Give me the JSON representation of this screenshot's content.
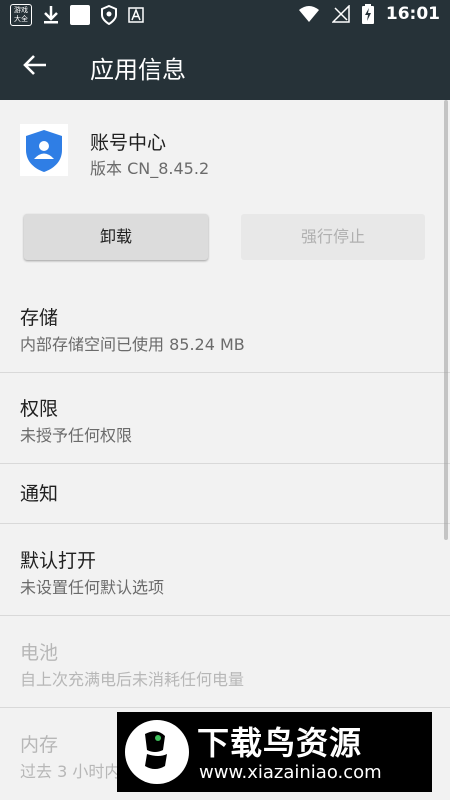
{
  "status_bar": {
    "game_icon_text": "游戏大全",
    "time": "16:01"
  },
  "app_bar": {
    "title": "应用信息"
  },
  "app": {
    "name": "账号中心",
    "version": "版本 CN_8.45.2"
  },
  "buttons": {
    "uninstall": "卸载",
    "force_stop": "强行停止"
  },
  "settings": [
    {
      "title": "存储",
      "subtitle": "内部存储空间已使用 85.24 MB"
    },
    {
      "title": "权限",
      "subtitle": "未授予任何权限"
    },
    {
      "title": "通知",
      "subtitle": ""
    },
    {
      "title": "默认打开",
      "subtitle": "未设置任何默认选项"
    },
    {
      "title": "电池",
      "subtitle": "自上次充满电后未消耗任何电量"
    },
    {
      "title": "内存",
      "subtitle": "过去 3 小时内"
    }
  ],
  "watermark": {
    "main": "下载鸟资源",
    "url": "www.xiazainiao.com"
  },
  "colors": {
    "app_bar": "#263238",
    "accent_blue": "#2f7ee5"
  }
}
